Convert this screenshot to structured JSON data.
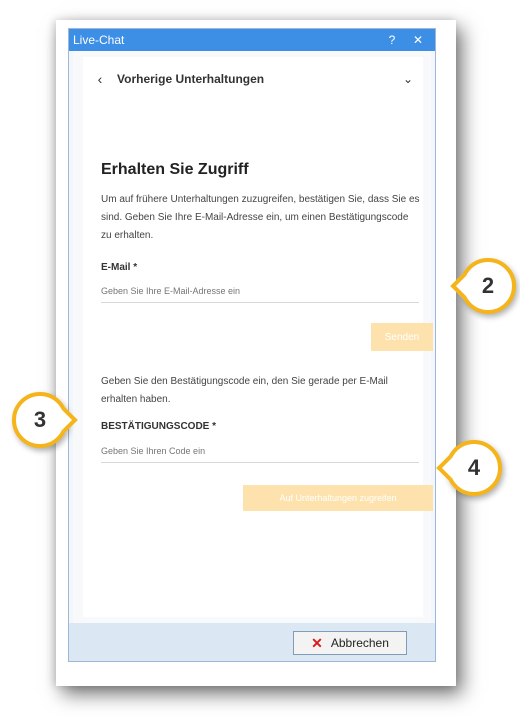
{
  "window": {
    "title": "Live-Chat",
    "help_label": "?",
    "close_label": "✕"
  },
  "header": {
    "back_icon": "‹",
    "title": "Vorherige Unterhaltungen",
    "chevron_icon": "⌄"
  },
  "form": {
    "heading": "Erhalten Sie Zugriff",
    "intro": "Um auf frühere Unterhaltungen zuzugreifen, bestätigen Sie, dass Sie es sind. Geben Sie Ihre E-Mail-Adresse ein, um einen Bestätigungscode zu erhalten.",
    "email_label": "E-Mail *",
    "email_placeholder": "Geben Sie Ihre E-Mail-Adresse ein",
    "send_label": "Senden",
    "code_instructions": "Geben Sie den Bestätigungscode ein, den Sie gerade per E-Mail erhalten haben.",
    "code_label": "BESTÄTIGUNGSCODE *",
    "code_placeholder": "Geben Sie Ihren Code ein",
    "access_label": "Auf Unterhaltungen zugreifen"
  },
  "footer": {
    "cancel_icon": "✕",
    "cancel_label": "Abbrechen"
  },
  "callouts": {
    "c2": "2",
    "c3": "3",
    "c4": "4"
  },
  "colors": {
    "titlebar": "#3d8fe6",
    "button_disabled": "#fde2ad",
    "callout_ring": "#f4b41a",
    "cancel_icon": "#d61c1c"
  }
}
